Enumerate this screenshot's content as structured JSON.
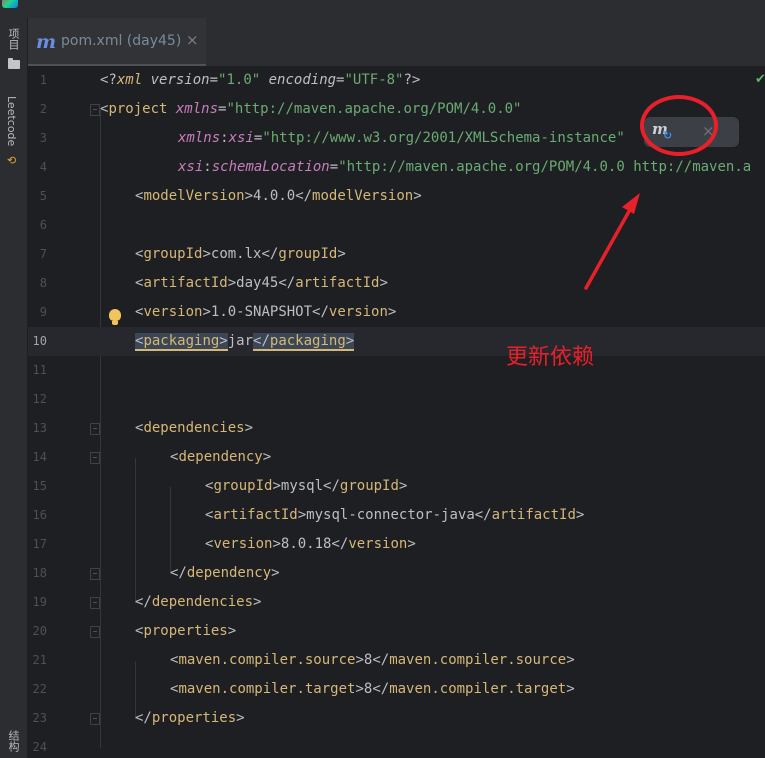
{
  "left_toolbar": {
    "project": "项目",
    "leetcode": "Leetcode",
    "structure": "结构"
  },
  "tab": {
    "icon": "maven-m-icon",
    "label": "pom.xml (day45)",
    "close": "×"
  },
  "editor": {
    "line_numbers": [
      "1",
      "2",
      "3",
      "4",
      "5",
      "6",
      "7",
      "8",
      "9",
      "10",
      "11",
      "12",
      "13",
      "14",
      "15",
      "16",
      "17",
      "18",
      "19",
      "20",
      "21",
      "22",
      "23",
      "24"
    ],
    "current_line": "10",
    "lines": {
      "l1": {
        "a": "<?",
        "b": "xml",
        "c": " version",
        "d": "=",
        "e": "\"1.0\"",
        "f": " encoding",
        "g": "=",
        "h": "\"UTF-8\"",
        "i": "?>"
      },
      "l2": {
        "a": "<",
        "b": "project",
        "c": " xmlns",
        "d": "=",
        "e": "\"http://maven.apache.org/POM/4.0.0\""
      },
      "l3": {
        "a": "xmlns",
        "b": ":",
        "c": "xsi",
        "d": "=",
        "e": "\"http://www.w3.org/2001/XMLSchema-instance\""
      },
      "l4": {
        "a": "xsi",
        "b": ":",
        "c": "schemaLocation",
        "d": "=",
        "e": "\"http://maven.apache.org/POM/4.0.0 http://maven.a"
      },
      "l5": {
        "tag": "modelVersion",
        "text": "4.0.0"
      },
      "l7": {
        "tag": "groupId",
        "text": "com.lx"
      },
      "l8": {
        "tag": "artifactId",
        "text": "day45"
      },
      "l9": {
        "tag": "version",
        "text": "1.0-SNAPSHOT"
      },
      "l10": {
        "tag": "packaging",
        "text": "jar"
      },
      "l13": {
        "tag": "dependencies"
      },
      "l14": {
        "tag": "dependency"
      },
      "l15": {
        "tag": "groupId",
        "text": "mysql"
      },
      "l16": {
        "tag": "artifactId",
        "text": "mysql-connector-java"
      },
      "l17": {
        "tag": "version",
        "text": "8.0.18"
      },
      "l18": {
        "tag": "dependency"
      },
      "l19": {
        "tag": "dependencies"
      },
      "l20": {
        "tag": "properties"
      },
      "l21": {
        "tag": "maven.compiler.source",
        "text": "8"
      },
      "l22": {
        "tag": "maven.compiler.target",
        "text": "8"
      },
      "l23": {
        "tag": "properties"
      }
    }
  },
  "maven_popup": {
    "reload_icon": "maven-reload-icon",
    "close": "×"
  },
  "annotation": {
    "text": "更新依赖",
    "color": "#e8202a"
  },
  "colors": {
    "tag": "#d5b778",
    "attribute": "#c77dbb",
    "string": "#6aab73",
    "background": "#1e1f22"
  }
}
